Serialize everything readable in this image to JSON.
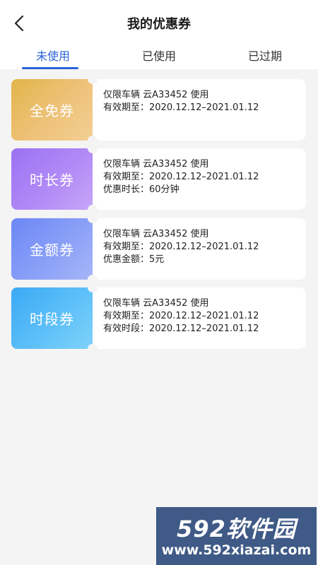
{
  "header": {
    "title": "我的优惠券",
    "back_icon": "chevron-left-icon"
  },
  "tabs": [
    {
      "label": "未使用",
      "active": true
    },
    {
      "label": "已使用",
      "active": false
    },
    {
      "label": "已过期",
      "active": false
    }
  ],
  "colors": {
    "accent": "#2a62d8",
    "gold": "#e2b54a",
    "purple": "#9a72f3",
    "blue": "#6c87f6",
    "cyan": "#3aa9f5"
  },
  "coupons": [
    {
      "type_label": "全免券",
      "line1": "仅限车辆 云A33452 使用",
      "line2": "有效期至：2020.12.12–2021.01.12"
    },
    {
      "type_label": "时长券",
      "line1": "仅限车辆 云A33452 使用",
      "line2": "有效期至：2020.12.12–2021.01.12",
      "line3": "优惠时长：60分钟"
    },
    {
      "type_label": "金额券",
      "line1": "仅限车辆 云A33452 使用",
      "line2": "有效期至：2020.12.12–2021.01.12",
      "line3": "优惠金额：5元"
    },
    {
      "type_label": "时段券",
      "line1": "仅限车辆 云A33452 使用",
      "line2": "有效期至：2020.12.12–2021.01.12",
      "line3": "有效时段：2020.12.12–2021.01.12"
    }
  ],
  "watermark": {
    "brand": "592软件园",
    "url": "www.592xiazai.com"
  }
}
